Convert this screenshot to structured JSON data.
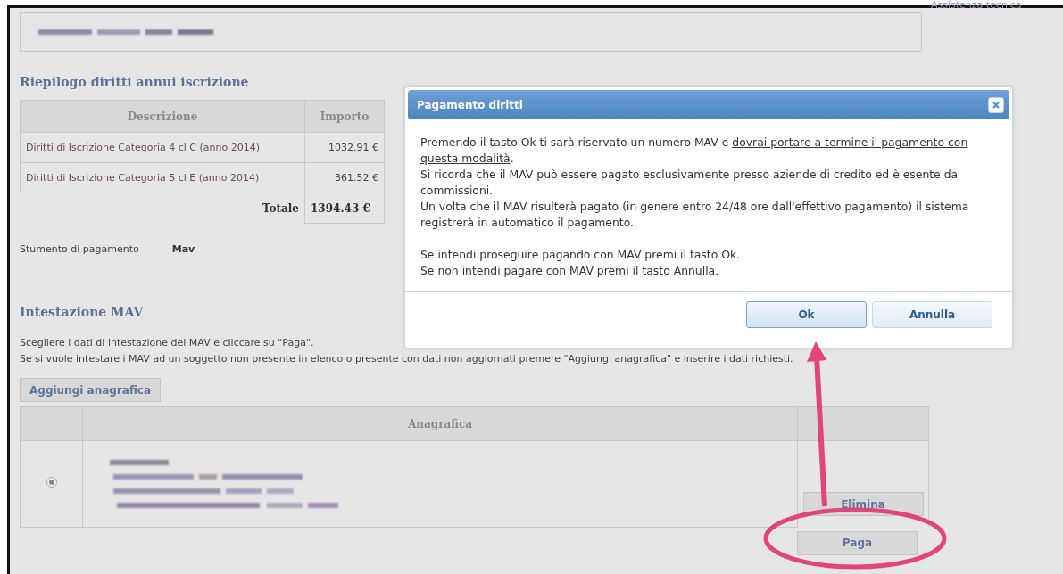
{
  "header": {
    "link": "Assistenza tecnica"
  },
  "summary": {
    "title": "Riepilogo diritti annui iscrizione",
    "columns": [
      "Descrizione",
      "Importo"
    ],
    "rows": [
      {
        "description": "Diritti di Iscrizione Categoria 4 cl C (anno 2014)",
        "amount": "1032.91 €"
      },
      {
        "description": "Diritti di Iscrizione Categoria 5 cl E (anno 2014)",
        "amount": "361.52 €"
      }
    ],
    "total_label": "Totale",
    "total": "1394.43  €"
  },
  "payment_method": {
    "label": "Stumento di pagamento",
    "value": "Mav"
  },
  "mav": {
    "title": "Intestazione MAV",
    "lines": [
      "Scegliere i dati di intestazione del MAV e cliccare su \"Paga\".",
      "Se si vuole intestare i MAV ad un soggetto non presente in elenco o presente con dati non aggiornati premere \"Aggiungi anagrafica\" e inserire i dati richiesti."
    ],
    "add_button": "Aggiungi anagrafica",
    "columns": [
      "Anagrafica"
    ],
    "rows": [
      {
        "selected": true,
        "delete_button": "Elimina"
      }
    ],
    "pay_button": "Paga"
  },
  "dialog": {
    "title": "Pagamento diritti",
    "paragraphs": [
      {
        "before": "Premendo il tasto Ok ti sarà riservato un numero MAV e ",
        "underlined": "dovrai portare a termine il pagamento con questa modalità",
        "after": "."
      },
      {
        "text": "Si ricorda che il MAV può essere pagato esclusivamente presso aziende di credito ed è esente da commissioni."
      },
      {
        "text": "Un volta che il MAV risulterà pagato (in genere entro 24/48 ore dall'effettivo pagamento) il sistema registrerà in automatico il pagamento."
      }
    ],
    "prompts": [
      "Se intendi proseguire pagando con MAV premi il tasto Ok.",
      "Se non intendi pagare con MAV premi il tasto Annulla."
    ],
    "buttons": [
      {
        "label": "Ok",
        "focused": true
      },
      {
        "label": "Annulla",
        "focused": false
      }
    ]
  }
}
